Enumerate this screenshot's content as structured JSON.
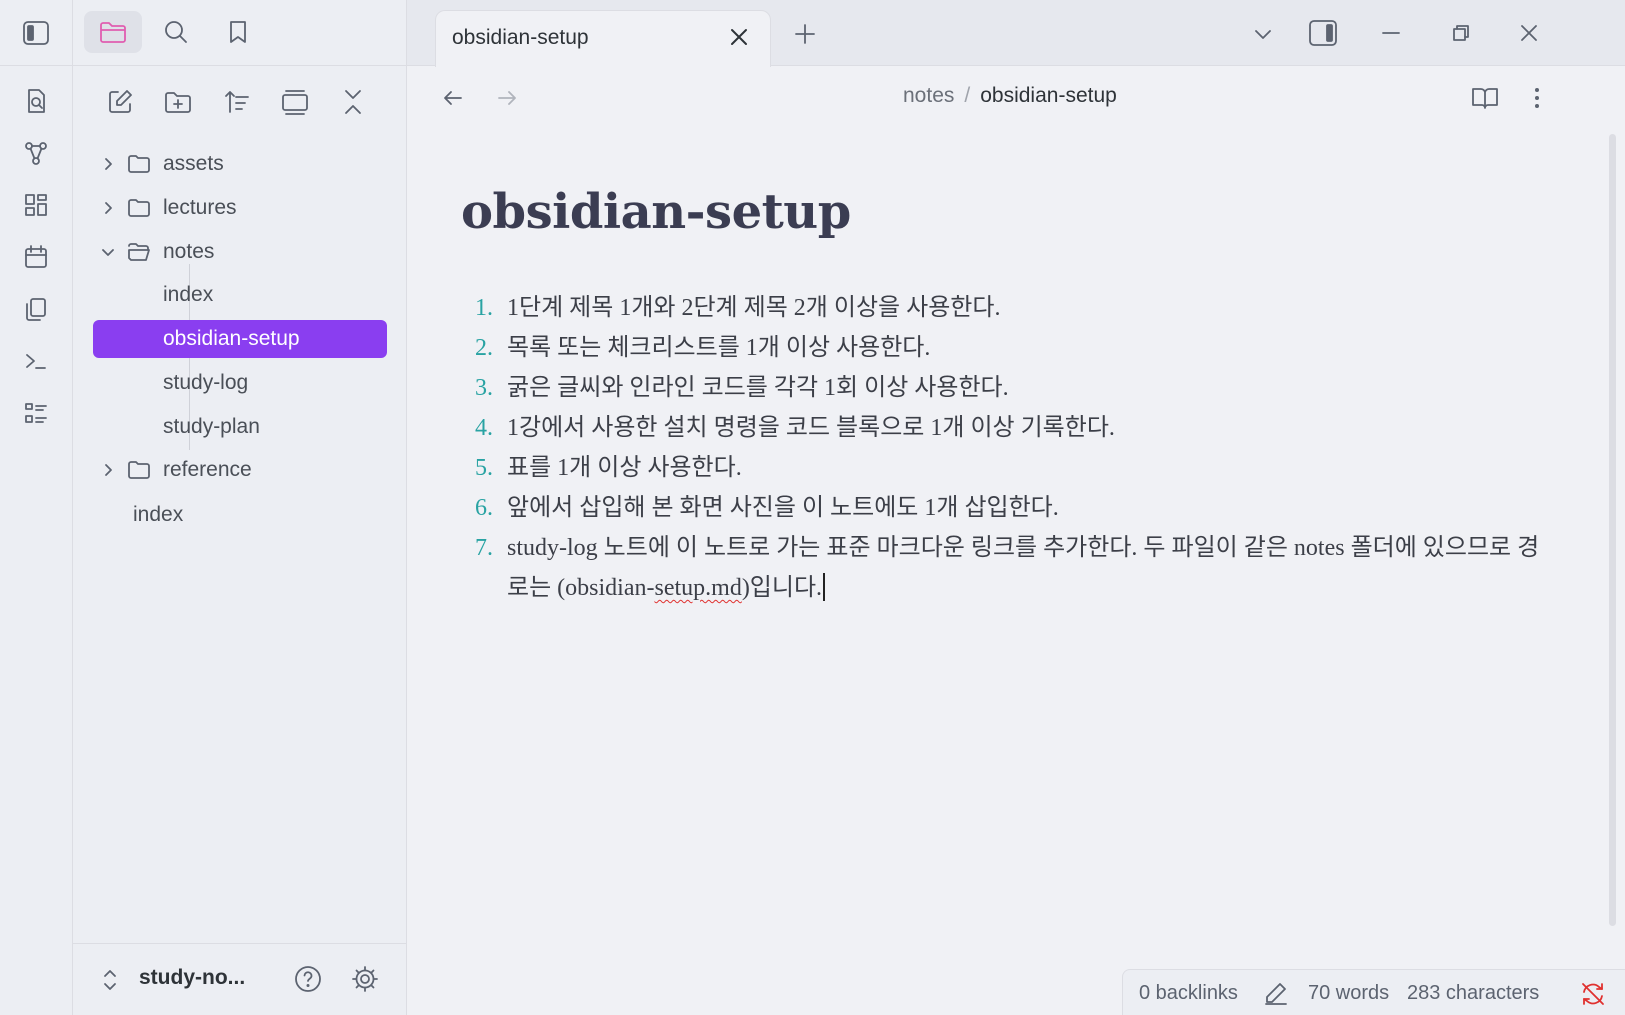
{
  "sidebar": {
    "tree": [
      {
        "label": "assets",
        "type": "folder",
        "expanded": false
      },
      {
        "label": "lectures",
        "type": "folder",
        "expanded": false
      },
      {
        "label": "notes",
        "type": "folder",
        "expanded": true
      },
      {
        "label": "index",
        "type": "file"
      },
      {
        "label": "obsidian-setup",
        "type": "file",
        "active": true
      },
      {
        "label": "study-log",
        "type": "file"
      },
      {
        "label": "study-plan",
        "type": "file"
      },
      {
        "label": "reference",
        "type": "folder",
        "expanded": false
      },
      {
        "label": "index",
        "type": "file"
      }
    ],
    "vault_name": "study-no..."
  },
  "tab": {
    "title": "obsidian-setup"
  },
  "breadcrumb": {
    "parent": "notes",
    "separator": "/",
    "current": "obsidian-setup"
  },
  "note": {
    "title": "obsidian-setup",
    "items": [
      {
        "num": "1.",
        "text": "1단계 제목 1개와 2단계 제목 2개 이상을 사용한다."
      },
      {
        "num": "2.",
        "text": "목록 또는 체크리스트를 1개 이상 사용한다."
      },
      {
        "num": "3.",
        "text": "굵은 글씨와 인라인 코드를 각각 1회 이상 사용한다."
      },
      {
        "num": "4.",
        "text": "1강에서 사용한 설치 명령을 코드 블록으로 1개 이상 기록한다."
      },
      {
        "num": "5.",
        "text": "표를 1개 이상 사용한다."
      },
      {
        "num": "6.",
        "text": "앞에서 삽입해 본 화면 사진을 이 노트에도 1개 삽입한다."
      },
      {
        "num": "7.",
        "text_before": "study-log 노트에 이 노트로 가는 표준 마크다운 링크를 추가한다. 두 파일이 같은 notes 폴더에 있으므로 경로는 (obsidian-",
        "text_squiggle": "setup.md",
        "text_after": ")입니다."
      }
    ]
  },
  "status": {
    "backlinks": "0 backlinks",
    "words": "70 words",
    "characters": "283 characters"
  },
  "colors": {
    "accent": "#8a3ef0",
    "list_number": "#29a3a3",
    "title": "#3b3d52",
    "active_folder_icon": "#e05db0"
  },
  "icons": [
    "sidebar-toggle-icon",
    "folder-icon",
    "search-icon",
    "bookmark-icon",
    "quick-switcher-icon",
    "graph-icon",
    "canvas-icon",
    "calendar-icon",
    "templates-icon",
    "terminal-icon",
    "command-palette-icon",
    "new-note-icon",
    "new-folder-icon",
    "sort-icon",
    "collapse-view-icon",
    "collapse-all-icon",
    "help-icon",
    "settings-icon",
    "close-icon",
    "plus-icon",
    "chevron-down-icon",
    "right-sidebar-icon",
    "minimize-icon",
    "restore-icon",
    "arrow-left-icon",
    "arrow-right-icon",
    "reading-view-icon",
    "more-options-icon",
    "pencil-icon",
    "sync-off-icon"
  ]
}
